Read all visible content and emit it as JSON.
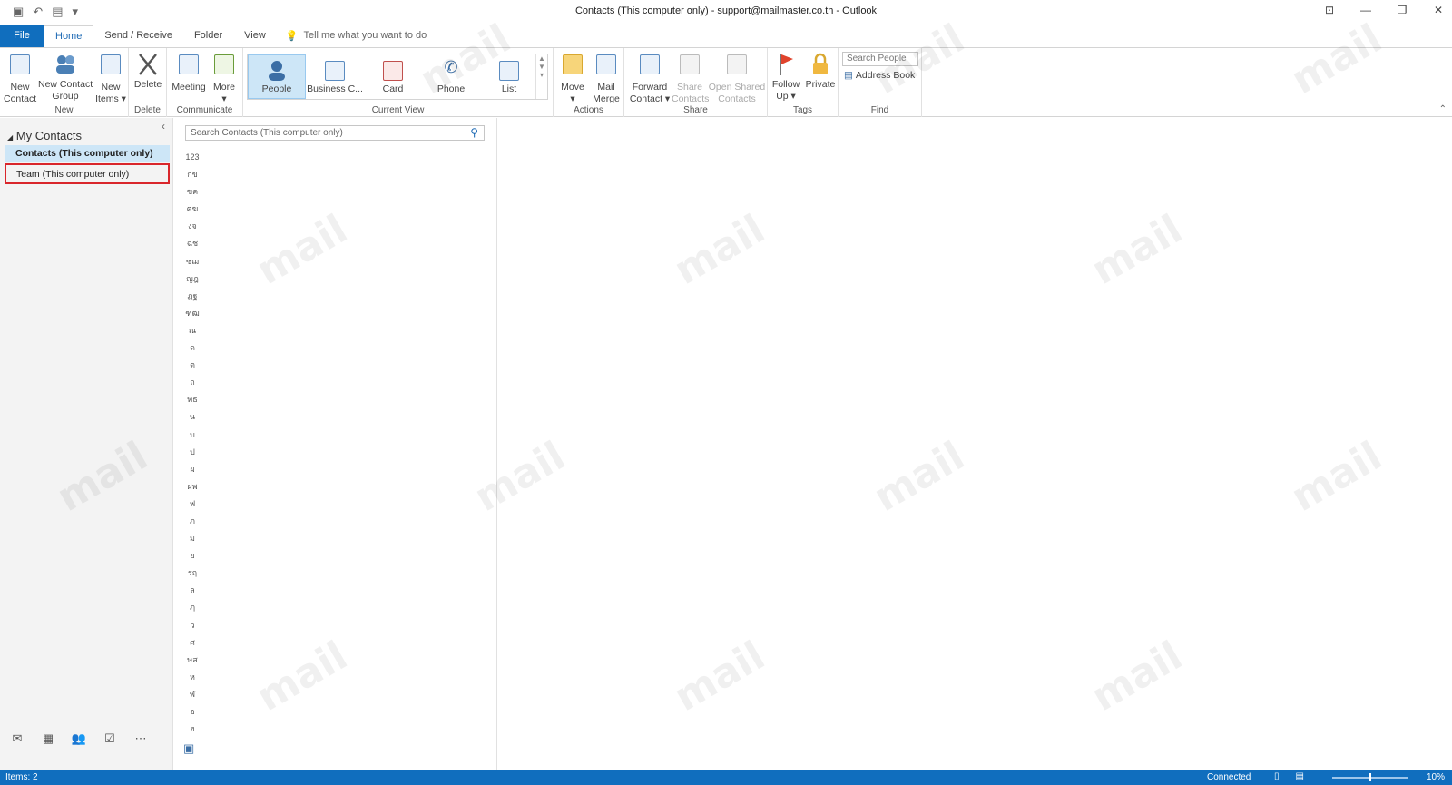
{
  "window": {
    "title": "Contacts (This computer only) - support@mailmaster.co.th  -  Outlook",
    "controls": [
      "restore-ribbon-icon",
      "minimize-icon",
      "restore-icon",
      "close-icon"
    ]
  },
  "tabs": {
    "file": "File",
    "home": "Home",
    "send_receive": "Send / Receive",
    "folder": "Folder",
    "view": "View",
    "tell_me": "Tell me what you want to do"
  },
  "ribbon": {
    "new": {
      "label": "New",
      "new_contact": "New\nContact",
      "new_contact_group": "New Contact\nGroup",
      "new_items": "New\nItems ▾"
    },
    "delete": {
      "label": "Delete",
      "delete": "Delete"
    },
    "communicate": {
      "label": "Communicate",
      "meeting": "Meeting",
      "more": "More\n▾"
    },
    "current_view": {
      "label": "Current View",
      "people": "People",
      "business_card": "Business C...",
      "card": "Card",
      "phone": "Phone",
      "list": "List"
    },
    "actions": {
      "label": "Actions",
      "move": "Move\n▾",
      "mail_merge": "Mail\nMerge"
    },
    "share": {
      "label": "Share",
      "forward_contact": "Forward\nContact ▾",
      "share_contacts": "Share\nContacts",
      "open_shared_contacts": "Open Shared\nContacts"
    },
    "tags": {
      "label": "Tags",
      "follow_up": "Follow\nUp ▾",
      "private": "Private"
    },
    "find": {
      "label": "Find",
      "search_people": "Search People",
      "address_book": "Address Book"
    }
  },
  "nav": {
    "section": "My Contacts",
    "folders": [
      "Contacts (This computer only)",
      "Team (This computer only)"
    ],
    "bottom": [
      "mail-icon",
      "calendar-icon",
      "people-icon",
      "tasks-icon",
      "more-icon"
    ]
  },
  "list": {
    "search_placeholder": "Search Contacts (This computer only)",
    "index": [
      "123",
      "กข",
      "ฃค",
      "ฅฆ",
      "งจ",
      "ฉช",
      "ซฌ",
      "ญฎ",
      "ฏฐ",
      "ฑฒ",
      "ณ",
      "ด",
      "ต",
      "ถ",
      "ทธ",
      "น",
      "บ",
      "ป",
      "ผ",
      "ฝพ",
      "ฟ",
      "ภ",
      "ม",
      "ย",
      "รฤ",
      "ล",
      "ฦ",
      "ว",
      "ศ",
      "ษส",
      "ห",
      "ฬ",
      "อ",
      "ฮ"
    ]
  },
  "status": {
    "items": "Items: 2",
    "connection": "Connected",
    "zoom": "10%"
  },
  "colors": {
    "accent": "#106ebe",
    "selection": "#cde6f7",
    "highlight_box": "#d9262b"
  }
}
